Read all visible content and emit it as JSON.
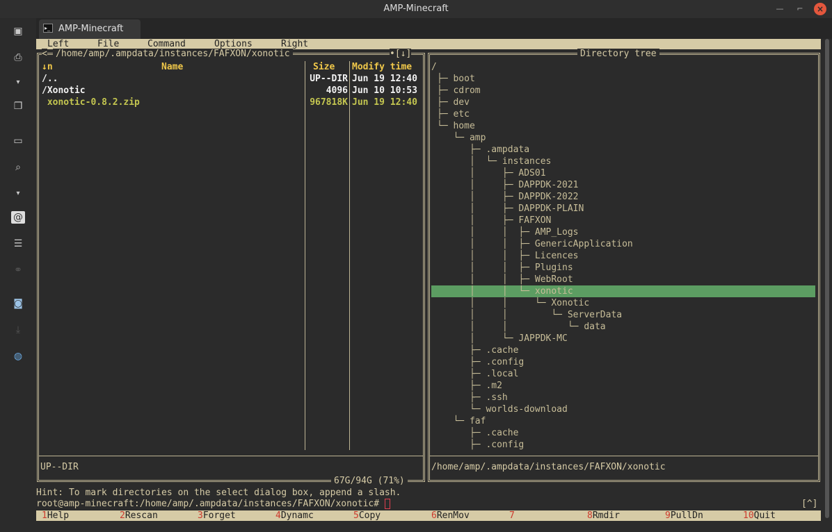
{
  "window": {
    "title": "AMP-Minecraft"
  },
  "tab": {
    "label": "AMP-Minecraft"
  },
  "menu": [
    "Left",
    "File",
    "Command",
    "Options",
    "Right"
  ],
  "left_panel": {
    "path": "/home/amp/.ampdata/instances/FAFXON/xonotic",
    "indicator": "•[↓]",
    "headers": {
      "sort": "↓n",
      "name": "Name",
      "size": "Size",
      "mtime": "Modify time"
    },
    "rows": [
      {
        "name": "/..",
        "size": "UP--DIR",
        "mtime": "Jun 19 12:40"
      },
      {
        "name": "/Xonotic",
        "size": "4096",
        "mtime": "Jun 10 10:53"
      },
      {
        "name": " xonotic-0.8.2.zip",
        "size": "967818K",
        "mtime": "Jun 19 12:40"
      }
    ],
    "status": "UP--DIR",
    "disk": "67G/94G (71%)"
  },
  "right_panel": {
    "title": "Directory tree",
    "root": "/",
    "tree": [
      "├─ boot",
      "├─ cdrom",
      "├─ dev",
      "├─ etc",
      "└─ home",
      "   └─ amp",
      "      ├─ .ampdata",
      "      │  └─ instances",
      "      │     ├─ ADS01",
      "      │     ├─ DAPPDK-2021",
      "      │     ├─ DAPPDK-2022",
      "      │     ├─ DAPPDK-PLAIN",
      "      │     ├─ FAFXON",
      "      │     │  ├─ AMP_Logs",
      "      │     │  ├─ GenericApplication",
      "      │     │  ├─ Licences",
      "      │     │  ├─ Plugins",
      "      │     │  ├─ WebRoot",
      "      │     │  └─ xonotic",
      "      │     │     └─ Xonotic",
      "      │     │        └─ ServerData",
      "      │     │           └─ data",
      "      │     └─ JAPPDK-MC",
      "      ├─ .cache",
      "      ├─ .config",
      "      ├─ .local",
      "      ├─ .m2",
      "      ├─ .ssh",
      "      └─ worlds-download",
      "   └─ faf",
      "      ├─ .cache",
      "      ├─ .config"
    ],
    "selected_index": 18,
    "path": "/home/amp/.ampdata/instances/FAFXON/xonotic"
  },
  "hint": "Hint: To mark directories on the select dialog box, append a slash.",
  "prompt": "root@amp-minecraft:/home/amp/.ampdata/instances/FAFXON/xonotic#",
  "prompt_right": "[^]",
  "fkeys": [
    {
      "num": "1",
      "label": "Help"
    },
    {
      "num": "2",
      "label": "Rescan"
    },
    {
      "num": "3",
      "label": "Forget"
    },
    {
      "num": "4",
      "label": "Dynamc"
    },
    {
      "num": "5",
      "label": "Copy"
    },
    {
      "num": "6",
      "label": "RenMov"
    },
    {
      "num": "7",
      "label": ""
    },
    {
      "num": "8",
      "label": "Rmdir"
    },
    {
      "num": "9",
      "label": "PullDn"
    },
    {
      "num": "10",
      "label": "Quit"
    }
  ],
  "sidebar_icons": [
    "workspace-icon",
    "print-icon",
    "expand-icon",
    "windows-icon",
    "window-icon",
    "search-window-icon",
    "expand-icon",
    "email-icon",
    "toggle-icon",
    "link-icon",
    "camera-icon",
    "download-icon",
    "globe-icon"
  ]
}
